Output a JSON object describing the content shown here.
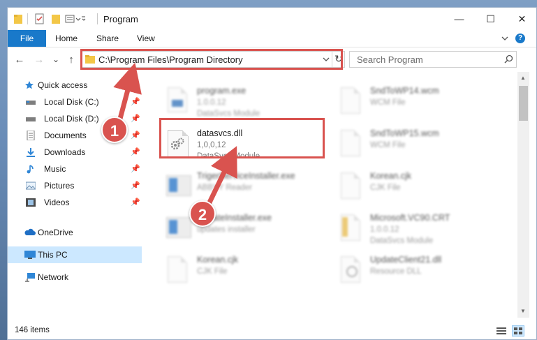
{
  "window": {
    "title": "Program",
    "controls": {
      "minimize": "—",
      "maximize": "☐",
      "close": "✕"
    }
  },
  "ribbon": {
    "tabs": [
      "File",
      "Home",
      "Share",
      "View"
    ],
    "expand_icon": "chevron-down-icon",
    "help_icon": "help-icon",
    "help_label": "?"
  },
  "nav": {
    "back": "←",
    "forward": "→",
    "recent": "⌄",
    "up": "↑",
    "address": "C:\\Program Files\\Program Directory",
    "refresh": "↻",
    "search_placeholder": "Search Program"
  },
  "sidebar": {
    "items": [
      {
        "label": "Quick access",
        "icon": "star-icon",
        "pinned": false
      },
      {
        "label": "Local Disk (C:)",
        "icon": "drive-icon",
        "pinned": true
      },
      {
        "label": "Local Disk (D:)",
        "icon": "drive-icon",
        "pinned": true
      },
      {
        "label": "Documents",
        "icon": "documents-icon",
        "pinned": true
      },
      {
        "label": "Downloads",
        "icon": "download-icon",
        "pinned": true
      },
      {
        "label": "Music",
        "icon": "music-icon",
        "pinned": true
      },
      {
        "label": "Pictures",
        "icon": "pictures-icon",
        "pinned": true
      },
      {
        "label": "Videos",
        "icon": "videos-icon",
        "pinned": true
      },
      {
        "label": "OneDrive",
        "icon": "cloud-icon",
        "pinned": false
      },
      {
        "label": "This PC",
        "icon": "computer-icon",
        "pinned": false,
        "selected": true
      },
      {
        "label": "Network",
        "icon": "network-icon",
        "pinned": false
      }
    ]
  },
  "files": [
    {
      "name": "program.exe",
      "line2": "1.0.0.12",
      "line3": "DataSvcs Module",
      "blurred": true
    },
    {
      "name": "SndToWP14.wcm",
      "line2": "WCM File",
      "line3": "",
      "blurred": true
    },
    {
      "name": "datasvcs.dll",
      "line2": "1,0,0,12",
      "line3": "DataSvcs Module",
      "blurred": false,
      "highlighted": true
    },
    {
      "name": "SndToWP15.wcm",
      "line2": "WCM File",
      "line3": "",
      "blurred": true
    },
    {
      "name": "TrigerServiceInstaller.exe",
      "line2": "ABBYY Reader",
      "line3": "",
      "blurred": true
    },
    {
      "name": "Korean.cjk",
      "line2": "CJK File",
      "line3": "",
      "blurred": true
    },
    {
      "name": "UpdateInstaller.exe",
      "line2": "updates installer",
      "line3": "",
      "blurred": true
    },
    {
      "name": "Microsoft.VC90.CRT",
      "line2": "1.0.0.12",
      "line3": "DataSvcs Module",
      "blurred": true
    },
    {
      "name": "Korean.cjk",
      "line2": "CJK File",
      "line3": "",
      "blurred": true
    },
    {
      "name": "UpdateClient21.dll",
      "line2": "Resource DLL",
      "line3": "",
      "blurred": true
    }
  ],
  "status": {
    "item_count": "146 items"
  },
  "annotations": {
    "step1": "1",
    "step2": "2",
    "color": "#d9534f"
  },
  "colors": {
    "file_tab": "#1979ca",
    "selected_nav": "#cce8ff",
    "annotation_red": "#d9534f"
  }
}
